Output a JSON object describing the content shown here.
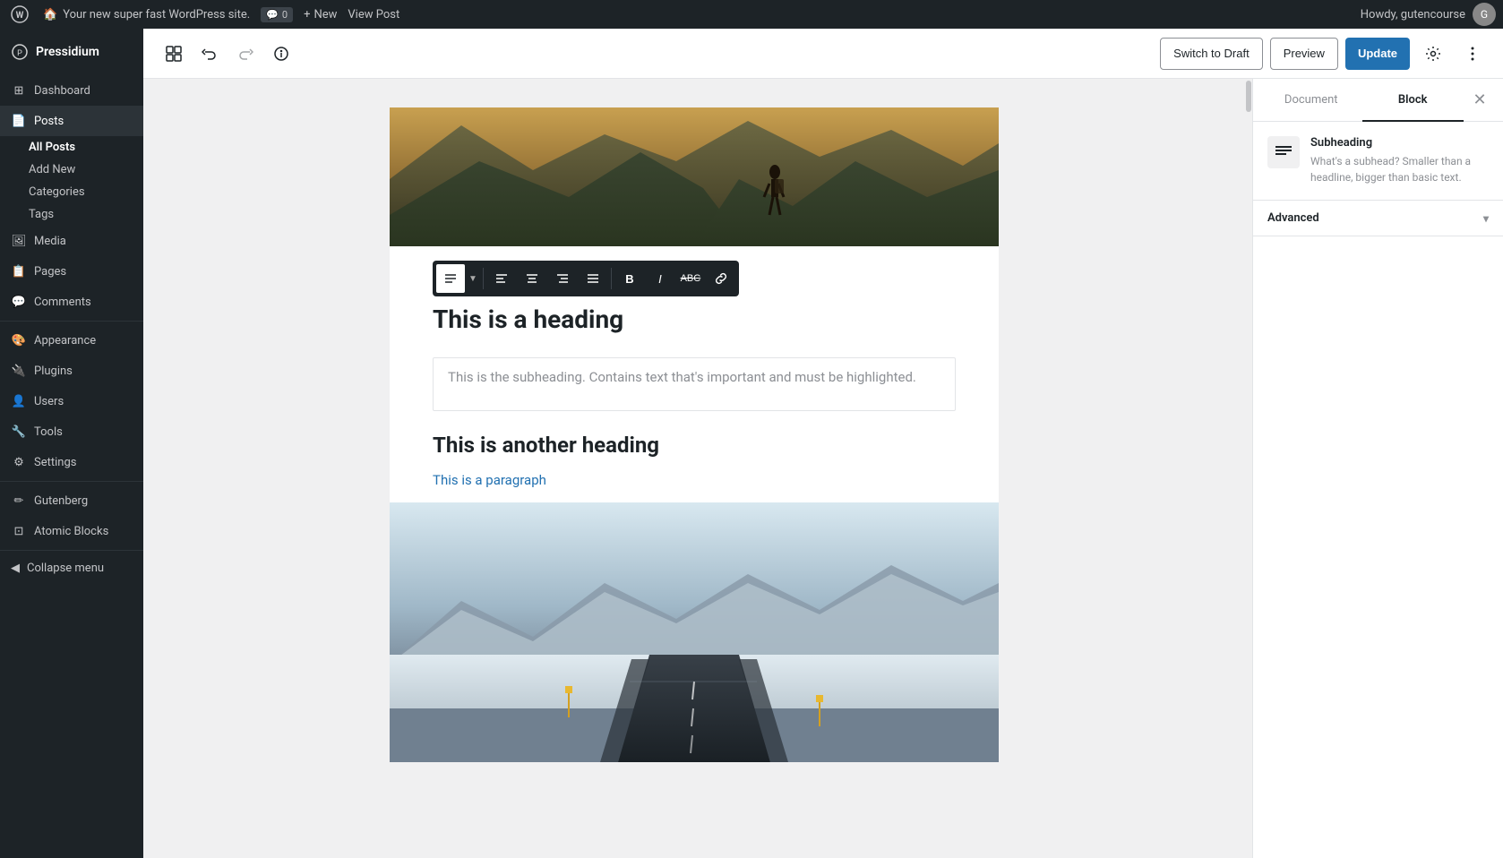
{
  "adminBar": {
    "siteName": "Your new super fast WordPress site.",
    "comments": "0",
    "newLabel": "New",
    "viewPost": "View Post",
    "howdy": "Howdy, gutencourse"
  },
  "sidebar": {
    "logoText": "Pressidium",
    "items": [
      {
        "id": "dashboard",
        "label": "Dashboard",
        "icon": "⊞"
      },
      {
        "id": "posts",
        "label": "Posts",
        "icon": "📄",
        "active": true
      },
      {
        "id": "media",
        "label": "Media",
        "icon": "🖼"
      },
      {
        "id": "pages",
        "label": "Pages",
        "icon": "📋"
      },
      {
        "id": "comments",
        "label": "Comments",
        "icon": "💬"
      },
      {
        "id": "appearance",
        "label": "Appearance",
        "icon": "🎨"
      },
      {
        "id": "plugins",
        "label": "Plugins",
        "icon": "🔌"
      },
      {
        "id": "users",
        "label": "Users",
        "icon": "👤"
      },
      {
        "id": "tools",
        "label": "Tools",
        "icon": "🔧"
      },
      {
        "id": "settings",
        "label": "Settings",
        "icon": "⚙"
      },
      {
        "id": "gutenberg",
        "label": "Gutenberg",
        "icon": "✏"
      },
      {
        "id": "atomic-blocks",
        "label": "Atomic Blocks",
        "icon": "⊡"
      }
    ],
    "postsSubItems": [
      {
        "id": "all-posts",
        "label": "All Posts",
        "active": true
      },
      {
        "id": "add-new",
        "label": "Add New"
      },
      {
        "id": "categories",
        "label": "Categories"
      },
      {
        "id": "tags",
        "label": "Tags"
      }
    ],
    "collapseMenu": "Collapse menu"
  },
  "toolbar": {
    "switchToDraftLabel": "Switch to Draft",
    "previewLabel": "Preview",
    "updateLabel": "Update",
    "addBlockTitle": "Add block",
    "undoTitle": "Undo",
    "redoTitle": "Redo",
    "infoTitle": "View post details"
  },
  "blockToolbar": {
    "alignLeft": "Align left",
    "alignCenter": "Align center",
    "alignRight": "Align right",
    "alignFull": "Align full",
    "bold": "Bold",
    "italic": "Italic",
    "strikethrough": "Strikethrough",
    "link": "Link"
  },
  "editor": {
    "heading": "This is a heading",
    "subheadingPlaceholder": "This is the subheading. Contains text that's important and must be highlighted.",
    "anotherHeading": "This is another heading",
    "paragraph": "This is a paragraph"
  },
  "rightPanel": {
    "documentTab": "Document",
    "blockTab": "Block",
    "blockIconSymbol": "≡",
    "blockTitle": "Subheading",
    "blockDescription": "What's a subhead? Smaller than a headline, bigger than basic text.",
    "advancedLabel": "Advanced"
  }
}
